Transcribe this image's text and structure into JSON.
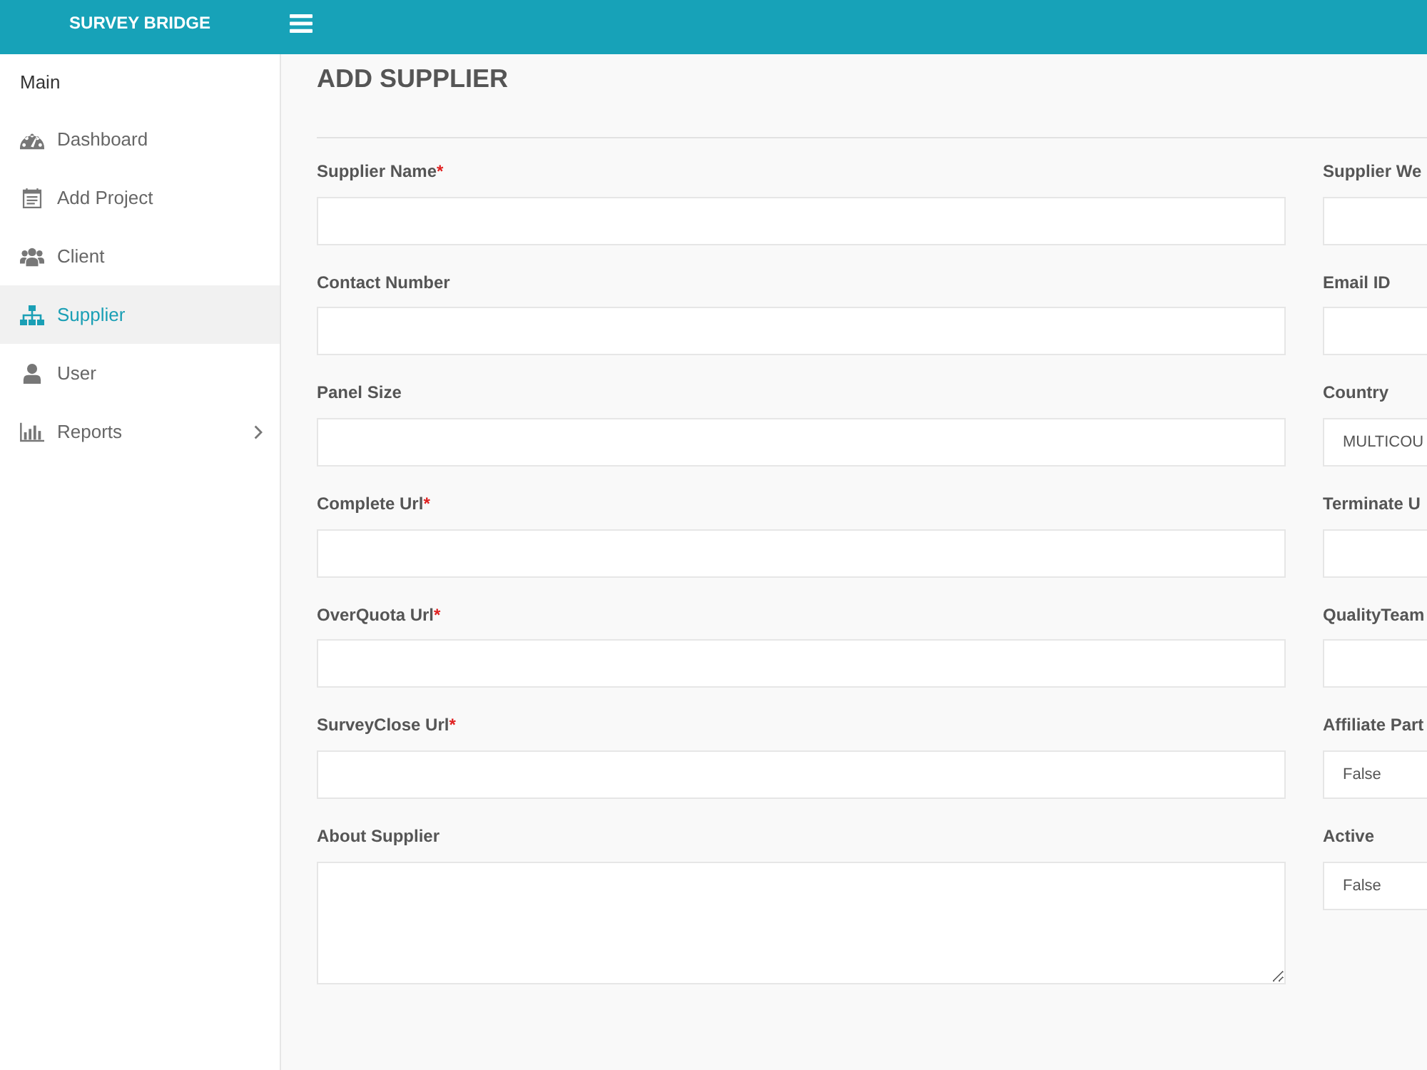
{
  "topbar": {
    "brand": "SURVEY BRIDGE"
  },
  "sidebar": {
    "heading": "Main",
    "items": [
      {
        "label": "Dashboard",
        "selected": false,
        "expandable": false
      },
      {
        "label": "Add Project",
        "selected": false,
        "expandable": false
      },
      {
        "label": "Client",
        "selected": false,
        "expandable": false
      },
      {
        "label": "Supplier",
        "selected": true,
        "expandable": false
      },
      {
        "label": "User",
        "selected": false,
        "expandable": false
      },
      {
        "label": "Reports",
        "selected": false,
        "expandable": true
      }
    ]
  },
  "form": {
    "title": "ADD SUPPLIER",
    "rows": [
      [
        {
          "label": "Supplier Name",
          "required_mark": "*",
          "kind": "text"
        },
        {
          "label": "Supplier We",
          "kind": "text"
        }
      ],
      [
        {
          "label": "Contact Number",
          "kind": "text"
        },
        {
          "label": "Email ID",
          "kind": "text"
        }
      ],
      [
        {
          "label": "Panel Size",
          "kind": "text"
        },
        {
          "label": "Country",
          "kind": "select",
          "value": "MULTICOU"
        }
      ],
      [
        {
          "label": "Complete Url",
          "required_mark": "*",
          "kind": "text"
        },
        {
          "label": "Terminate U",
          "kind": "text"
        }
      ],
      [
        {
          "label": "OverQuota Url",
          "required_mark": "*",
          "kind": "text"
        },
        {
          "label": "QualityTeam",
          "kind": "text"
        }
      ],
      [
        {
          "label": "SurveyClose Url",
          "required_mark": "*",
          "kind": "text"
        },
        {
          "label": "Affiliate Part",
          "kind": "select",
          "value": "False"
        }
      ],
      [
        {
          "label": "About Supplier",
          "kind": "textarea"
        },
        {
          "label": "Active",
          "kind": "select",
          "value": "False"
        }
      ]
    ]
  }
}
